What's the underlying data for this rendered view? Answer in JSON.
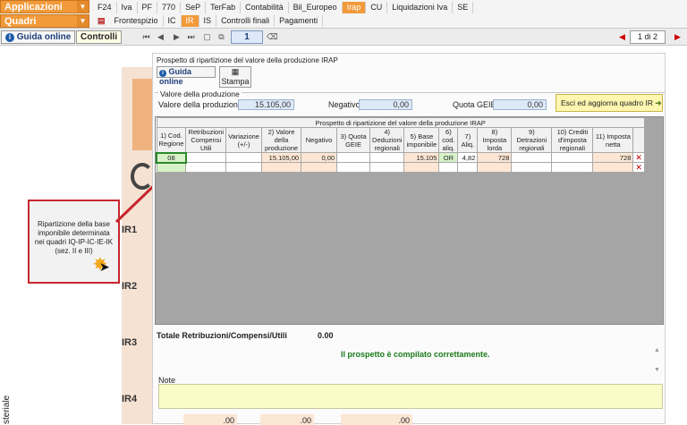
{
  "menu": {
    "app_select": "Applicazioni",
    "quadri_select": "Quadri",
    "app_items": [
      "F24",
      "Iva",
      "PF",
      "770",
      "SeP",
      "TerFab",
      "Contabilità",
      "Bil_Europeo",
      "Irap",
      "CU",
      "Liquidazioni Iva",
      "SE"
    ],
    "quadri_items": [
      "Frontespizio",
      "IC",
      "IR",
      "IS",
      "Controlli finali",
      "Pagamenti"
    ],
    "active_app": "Irap",
    "active_quadro": "IR"
  },
  "toolbar": {
    "guida_online": "Guida online",
    "controlli": "Controlli",
    "page_field": "1",
    "page_counter": "1 di 2"
  },
  "panel": {
    "title": "Prospetto di ripartizione del valore della produzione IRAP",
    "guida_online": "Guida online",
    "stampa": "Stampa",
    "section_label": "Valore della produzione",
    "valore_label": "Valore della produzione",
    "valore_value": "15.105,00",
    "negativo_label": "Negativo",
    "negativo_value": "0,00",
    "quota_label": "Quota GEIE",
    "quota_value": "0,00",
    "exit_button": "Esci ed aggiorna quadro IR",
    "grid_title": "Prospetto di ripartizione del valore della produzione IRAP",
    "columns": [
      "1) Cod. Regione",
      "Retribuzioni Compensi Utili",
      "Variazione (+/-)",
      "2) Valore della produzione",
      "Negativo",
      "3) Quota GEIE",
      "4) Deduzioni regionali",
      "5) Base imponibile",
      "6) cod. aliq.",
      "7) Aliq.",
      "8) Imposta lorda",
      "9) Detrazioni regionali",
      "10) Crediti d'imposta regionali",
      "11) Imposta netta"
    ],
    "rows": [
      [
        "08",
        "",
        "",
        "15.105,00",
        "0,00",
        "",
        "",
        "15.105",
        "OR",
        "4,82",
        "728",
        "",
        "",
        "728"
      ],
      [
        "",
        "",
        "",
        "",
        "",
        "",
        "",
        "",
        "",
        "",
        "",
        "",
        "",
        ""
      ]
    ],
    "totale_label": "Totale Retribuzioni/Compensi/Utili",
    "totale_value": "0.00",
    "status_message": "Il prospetto è compilato correttamente.",
    "note_label": "Note"
  },
  "background": {
    "callout_text": "Ripartizione della base imponibile determinata nei quadri IQ-IP-IC-IE-IK (sez. II e III)",
    "ir_labels": [
      "IR1",
      "IR2",
      "IR3",
      "IR4"
    ],
    "bottom_values": [
      ".00",
      ".00",
      ".00"
    ],
    "side_text": "steriale"
  },
  "colors": {
    "accent_orange": "#f29a3a",
    "arrow_red": "#c6262c",
    "status_green": "#1a7a1a"
  }
}
